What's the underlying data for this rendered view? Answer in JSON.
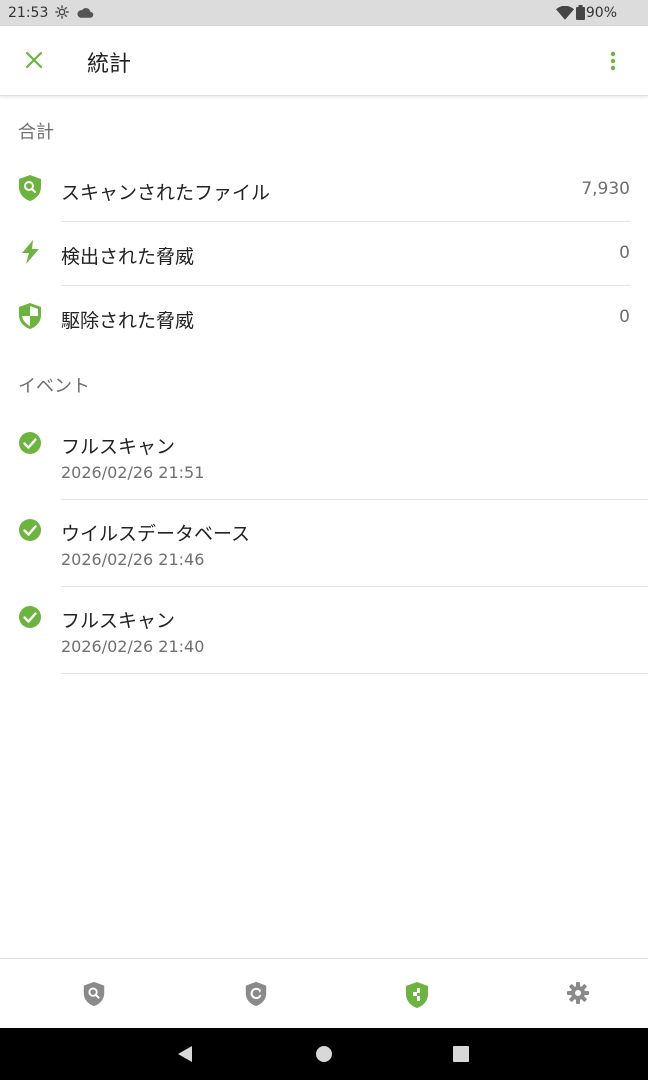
{
  "status_bar": {
    "time": "21:53",
    "battery_percent": "90%",
    "icons": [
      "settings-gear-icon",
      "cloud-icon",
      "wifi-icon",
      "battery-icon"
    ]
  },
  "app_bar": {
    "title": "統計",
    "close_icon": "close-icon",
    "menu_icon": "more-vert-icon"
  },
  "totals": {
    "header": "合計",
    "items": [
      {
        "label": "スキャンされたファイル",
        "value": "7,930",
        "icon": "shield-search-icon"
      },
      {
        "label": "検出された脅威",
        "value": "0",
        "icon": "lightning-icon"
      },
      {
        "label": "駆除された脅威",
        "value": "0",
        "icon": "shield-half-icon"
      }
    ]
  },
  "events": {
    "header": "イベント",
    "items": [
      {
        "title": "フルスキャン",
        "date": "2026/02/26 21:51",
        "icon": "check-circle-icon"
      },
      {
        "title": "ウイルスデータベース",
        "date": "2026/02/26 21:46",
        "icon": "check-circle-icon"
      },
      {
        "title": "フルスキャン",
        "date": "2026/02/26 21:40",
        "icon": "check-circle-icon"
      }
    ]
  },
  "bottom_nav": {
    "tabs": [
      {
        "icon": "shield-search-icon",
        "active": false
      },
      {
        "icon": "shield-update-icon",
        "active": false
      },
      {
        "icon": "shield-statistics-icon",
        "active": true
      },
      {
        "icon": "gear-icon",
        "active": false
      }
    ]
  },
  "colors": {
    "accent": "#6db33f",
    "inactive_icon": "#8a8a8a",
    "secondary_text": "#6f6f6f"
  }
}
